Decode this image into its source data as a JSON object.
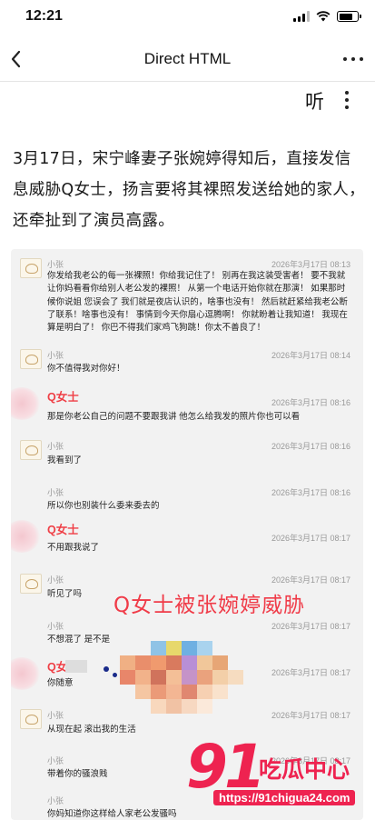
{
  "status_bar": {
    "time": "12:21"
  },
  "nav": {
    "title": "Direct HTML"
  },
  "reader": {
    "listen_label": "听"
  },
  "article": {
    "paragraph": "3月17日，宋宁峰妻子张婉婷得知后，直接发信息威胁Q女士，扬言要将其裸照发送给她的家人，还牵扯到了演员高露。"
  },
  "chat": {
    "messages": [
      {
        "sender": "小张",
        "timestamp": "2026年3月17日 08:13",
        "text": "你发给我老公的每一张裸照！你给我记住了！ 别再在我这装受害者！ 要不我就让你妈看看你给别人老公发的裸照！ 从第一个电话开始你就在那演！ 如果那时候你说姐 您误会了 我们就是夜店认识的，啥事也没有！ 然后就赶紧给我老公断了联系！啥事也没有！ 事情到今天你扇心逗腾啊！ 你就盼着让我知道！ 我现在算是明白了！ 你巴不得我们家鸡飞狗跳！你太不善良了！"
      },
      {
        "sender": "小张",
        "timestamp": "2026年3月17日 08:14",
        "text": "你不值得我对你好！"
      },
      {
        "sender": "Q女士",
        "timestamp": "2026年3月17日 08:16",
        "text": "那是你老公自己的问题不要跟我讲 他怎么给我发的照片你也可以看"
      },
      {
        "sender": "小张",
        "timestamp": "2026年3月17日 08:16",
        "text": "我看到了"
      },
      {
        "sender": "小张",
        "timestamp": "2026年3月17日 08:16",
        "text": "所以你也别装什么委来委去的"
      },
      {
        "sender": "Q女士",
        "timestamp": "2026年3月17日 08:17",
        "text": "不用跟我说了"
      },
      {
        "sender": "小张",
        "timestamp": "2026年3月17日 08:17",
        "text": "听见了吗"
      },
      {
        "sender": "小张",
        "timestamp": "2026年3月17日 08:17",
        "text": "不想混了 是不是"
      },
      {
        "sender": "Q女士",
        "timestamp": "2026年3月17日 08:17",
        "text": "你随意"
      },
      {
        "sender": "小张",
        "timestamp": "2026年3月17日 08:17",
        "text": "从现在起 滚出我的生活"
      },
      {
        "sender": "小张",
        "timestamp": "2026年3月17日 08:17",
        "text": "带着你的骚浪贱"
      },
      {
        "sender": "小张",
        "timestamp": "",
        "text": "你妈知道你这样给人家老公发骚吗"
      }
    ],
    "overlay_caption": "Q女士被张婉婷威胁"
  },
  "watermark": {
    "logo_number": "91",
    "logo_text": "吃瓜中心",
    "url": "https://91chigua24.com"
  },
  "colors": {
    "accent_red": "#ef3f46",
    "watermark_pink": "#ee2350",
    "chat_background": "#f2f2f2"
  }
}
